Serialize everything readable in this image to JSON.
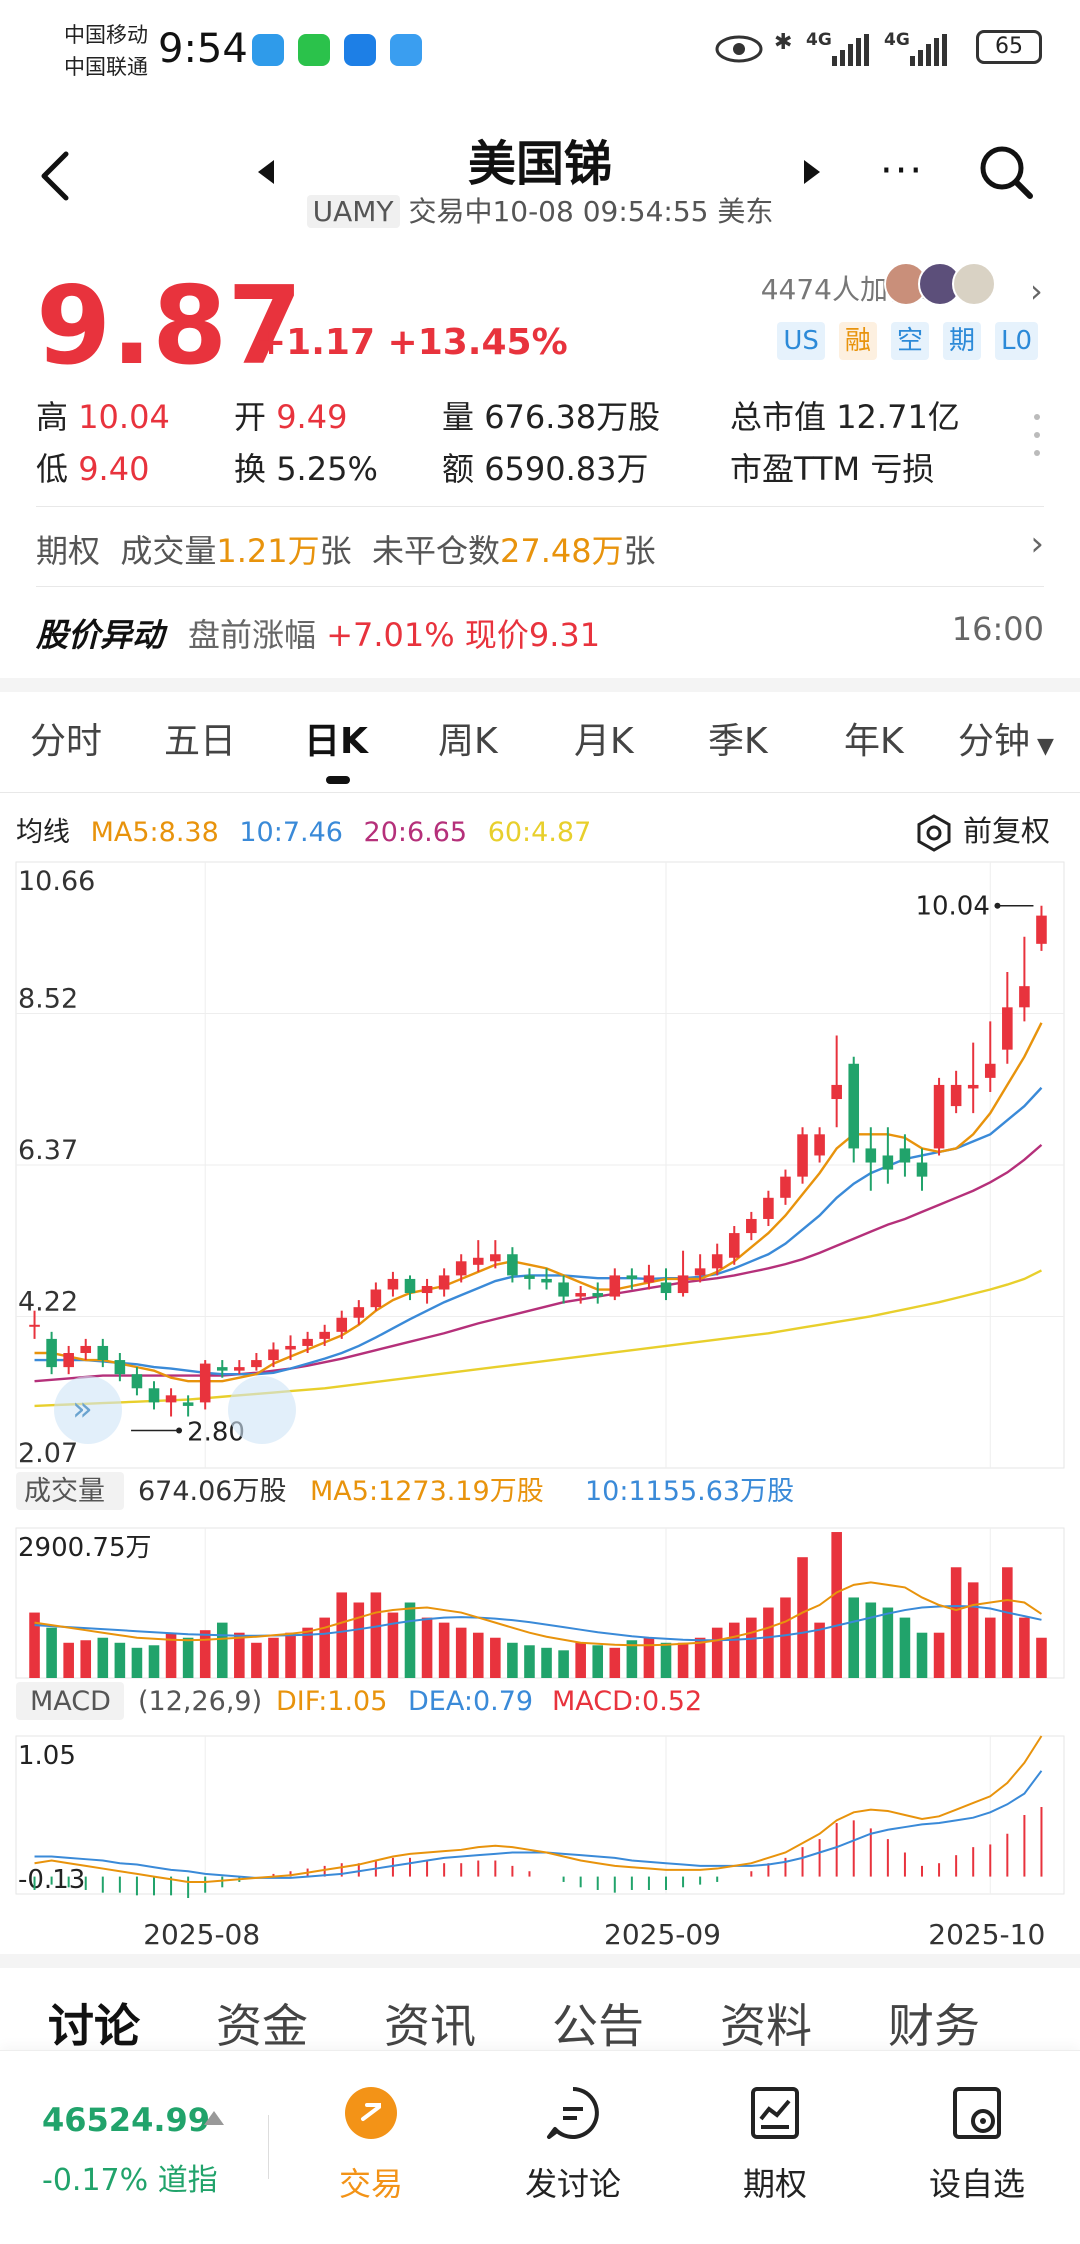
{
  "status_bar": {
    "carrier1": "中国移动",
    "carrier2": "中国联通",
    "time": "9:54",
    "network1": "4G",
    "network2": "4G",
    "battery": "65"
  },
  "header": {
    "title": "美国锑",
    "ticker": "UAMY",
    "status": "交易中10-08 09:54:55 美东"
  },
  "quote": {
    "price": "9.87",
    "change": "+1.17",
    "change_pct": "+13.45%",
    "watch_count": "4474人加自选",
    "badges": [
      "US",
      "融",
      "空",
      "期",
      "L0"
    ]
  },
  "stats": {
    "high_label": "高",
    "high": "10.04",
    "open_label": "开",
    "open": "9.49",
    "volume_label": "量",
    "volume": "676.38万股",
    "mcap_label": "总市值",
    "mcap": "12.71亿",
    "low_label": "低",
    "low": "9.40",
    "turnover_label": "换",
    "turnover": "5.25%",
    "amount_label": "额",
    "amount": "6590.83万",
    "pe_label": "市盈TTM",
    "pe": "亏损"
  },
  "options": {
    "label": "期权",
    "vol_label": "成交量",
    "vol": "1.21万",
    "vol_unit": "张",
    "oi_label": "未平仓数",
    "oi": "27.48万",
    "oi_unit": "张"
  },
  "alert": {
    "title": "股价异动",
    "text": "盘前涨幅",
    "pct": "+7.01%",
    "now": "现价9.31",
    "time": "16:00"
  },
  "tabs": [
    "分时",
    "五日",
    "日K",
    "周K",
    "月K",
    "季K",
    "年K",
    "分钟"
  ],
  "ma": {
    "label": "均线",
    "ma5": "MA5:8.38",
    "ma10": "10:7.46",
    "ma20": "20:6.65",
    "ma60": "60:4.87",
    "adjust": "前复权"
  },
  "volume_info": {
    "label": "成交量",
    "value": "674.06万股",
    "ma5": "MA5:1273.19万股",
    "ma10": "10:1155.63万股",
    "max": "2900.75万"
  },
  "macd_info": {
    "label": "MACD",
    "params": "(12,26,9)",
    "dif": "DIF:1.05",
    "dea": "DEA:0.79",
    "macd": "MACD:0.52",
    "top": "1.05",
    "bottom": "-0.13"
  },
  "chart_data": {
    "type": "candlestick",
    "y_ticks": [
      "10.66",
      "8.52",
      "6.37",
      "4.22",
      "2.07"
    ],
    "ylim": [
      2.07,
      10.66
    ],
    "x_labels": [
      "2025-08",
      "2025-09",
      "2025-10"
    ],
    "high_marker": "10.04",
    "low_marker": "2.80",
    "candles": [
      [
        4.1,
        4.1,
        3.9,
        4.3
      ],
      [
        3.9,
        3.5,
        3.4,
        4.0
      ],
      [
        3.5,
        3.7,
        3.4,
        3.8
      ],
      [
        3.7,
        3.8,
        3.6,
        3.9
      ],
      [
        3.8,
        3.6,
        3.5,
        3.9
      ],
      [
        3.6,
        3.4,
        3.3,
        3.7
      ],
      [
        3.4,
        3.2,
        3.1,
        3.5
      ],
      [
        3.2,
        3.0,
        2.9,
        3.3
      ],
      [
        3.0,
        3.1,
        2.8,
        3.2
      ],
      [
        3.0,
        2.95,
        2.8,
        3.1
      ],
      [
        3.0,
        3.55,
        2.9,
        3.6
      ],
      [
        3.5,
        3.45,
        3.35,
        3.6
      ],
      [
        3.45,
        3.5,
        3.4,
        3.6
      ],
      [
        3.5,
        3.6,
        3.45,
        3.7
      ],
      [
        3.6,
        3.75,
        3.5,
        3.85
      ],
      [
        3.75,
        3.8,
        3.6,
        3.95
      ],
      [
        3.8,
        3.9,
        3.7,
        4.0
      ],
      [
        3.9,
        4.0,
        3.8,
        4.1
      ],
      [
        4.0,
        4.2,
        3.9,
        4.3
      ],
      [
        4.2,
        4.35,
        4.1,
        4.45
      ],
      [
        4.35,
        4.6,
        4.3,
        4.7
      ],
      [
        4.6,
        4.75,
        4.5,
        4.85
      ],
      [
        4.75,
        4.55,
        4.45,
        4.8
      ],
      [
        4.55,
        4.65,
        4.4,
        4.75
      ],
      [
        4.6,
        4.8,
        4.5,
        4.9
      ],
      [
        4.8,
        5.0,
        4.7,
        5.1
      ],
      [
        4.95,
        5.05,
        4.85,
        5.3
      ],
      [
        5.0,
        5.1,
        4.9,
        5.3
      ],
      [
        5.1,
        4.8,
        4.7,
        5.2
      ],
      [
        4.8,
        4.75,
        4.6,
        4.9
      ],
      [
        4.75,
        4.7,
        4.6,
        4.9
      ],
      [
        4.7,
        4.5,
        4.4,
        4.8
      ],
      [
        4.5,
        4.55,
        4.4,
        4.65
      ],
      [
        4.55,
        4.5,
        4.4,
        4.7
      ],
      [
        4.5,
        4.8,
        4.45,
        4.9
      ],
      [
        4.8,
        4.75,
        4.6,
        4.9
      ],
      [
        4.7,
        4.8,
        4.6,
        4.95
      ],
      [
        4.7,
        4.55,
        4.45,
        4.9
      ],
      [
        4.55,
        4.8,
        4.5,
        5.15
      ],
      [
        4.8,
        4.9,
        4.7,
        5.1
      ],
      [
        4.9,
        5.1,
        4.8,
        5.25
      ],
      [
        5.05,
        5.4,
        4.95,
        5.5
      ],
      [
        5.4,
        5.6,
        5.3,
        5.7
      ],
      [
        5.6,
        5.9,
        5.5,
        6.0
      ],
      [
        5.9,
        6.2,
        5.8,
        6.3
      ],
      [
        6.2,
        6.8,
        6.1,
        6.9
      ],
      [
        6.5,
        6.8,
        6.4,
        6.9
      ],
      [
        7.3,
        7.5,
        6.9,
        8.2
      ],
      [
        7.8,
        6.6,
        6.4,
        7.9
      ],
      [
        6.6,
        6.4,
        6.0,
        6.9
      ],
      [
        6.5,
        6.3,
        6.1,
        6.9
      ],
      [
        6.6,
        6.4,
        6.2,
        6.8
      ],
      [
        6.4,
        6.2,
        6.0,
        6.6
      ],
      [
        6.6,
        7.5,
        6.5,
        7.6
      ],
      [
        7.2,
        7.5,
        7.1,
        7.7
      ],
      [
        7.45,
        7.5,
        7.1,
        8.1
      ],
      [
        7.6,
        7.8,
        7.4,
        8.4
      ],
      [
        8.0,
        8.6,
        7.8,
        9.1
      ],
      [
        8.6,
        8.9,
        8.4,
        9.6
      ],
      [
        9.5,
        9.9,
        9.4,
        10.04
      ]
    ],
    "ma5": [
      3.7,
      3.7,
      3.65,
      3.6,
      3.6,
      3.55,
      3.5,
      3.45,
      3.35,
      3.3,
      3.3,
      3.3,
      3.35,
      3.4,
      3.55,
      3.65,
      3.75,
      3.85,
      3.95,
      4.1,
      4.3,
      4.45,
      4.55,
      4.6,
      4.65,
      4.75,
      4.85,
      4.95,
      5.0,
      4.95,
      4.9,
      4.8,
      4.7,
      4.6,
      4.6,
      4.65,
      4.7,
      4.75,
      4.75,
      4.75,
      4.85,
      5.0,
      5.2,
      5.4,
      5.65,
      5.95,
      6.25,
      6.6,
      6.8,
      6.8,
      6.8,
      6.75,
      6.6,
      6.55,
      6.6,
      6.8,
      7.1,
      7.5,
      7.9,
      8.38
    ],
    "ma10": [
      3.6,
      3.6,
      3.6,
      3.6,
      3.58,
      3.56,
      3.54,
      3.5,
      3.48,
      3.45,
      3.42,
      3.4,
      3.4,
      3.4,
      3.42,
      3.48,
      3.55,
      3.62,
      3.7,
      3.8,
      3.92,
      4.05,
      4.18,
      4.3,
      4.42,
      4.52,
      4.62,
      4.72,
      4.78,
      4.8,
      4.8,
      4.8,
      4.78,
      4.76,
      4.76,
      4.76,
      4.75,
      4.76,
      4.76,
      4.78,
      4.82,
      4.9,
      5.0,
      5.1,
      5.25,
      5.45,
      5.65,
      5.9,
      6.1,
      6.25,
      6.35,
      6.45,
      6.5,
      6.55,
      6.6,
      6.7,
      6.8,
      7.0,
      7.2,
      7.46
    ],
    "ma20": [
      3.3,
      3.32,
      3.34,
      3.36,
      3.38,
      3.38,
      3.38,
      3.38,
      3.38,
      3.38,
      3.38,
      3.38,
      3.4,
      3.42,
      3.45,
      3.48,
      3.52,
      3.57,
      3.62,
      3.68,
      3.74,
      3.8,
      3.86,
      3.92,
      3.98,
      4.05,
      4.12,
      4.18,
      4.24,
      4.3,
      4.36,
      4.42,
      4.46,
      4.5,
      4.54,
      4.58,
      4.62,
      4.66,
      4.7,
      4.73,
      4.76,
      4.8,
      4.85,
      4.9,
      4.96,
      5.03,
      5.12,
      5.22,
      5.32,
      5.42,
      5.52,
      5.6,
      5.7,
      5.8,
      5.9,
      6.0,
      6.12,
      6.26,
      6.44,
      6.65
    ],
    "ma60": [
      2.95,
      2.96,
      2.97,
      2.98,
      2.99,
      3.0,
      3.01,
      3.02,
      3.03,
      3.04,
      3.06,
      3.08,
      3.1,
      3.12,
      3.14,
      3.16,
      3.18,
      3.2,
      3.23,
      3.26,
      3.29,
      3.32,
      3.35,
      3.38,
      3.41,
      3.44,
      3.47,
      3.5,
      3.53,
      3.56,
      3.59,
      3.62,
      3.65,
      3.68,
      3.71,
      3.74,
      3.77,
      3.8,
      3.83,
      3.86,
      3.89,
      3.92,
      3.95,
      3.98,
      4.02,
      4.06,
      4.1,
      4.14,
      4.18,
      4.22,
      4.27,
      4.32,
      4.37,
      4.42,
      4.48,
      4.54,
      4.6,
      4.67,
      4.75,
      4.87
    ],
    "volumes": [
      1300,
      1000,
      700,
      750,
      800,
      700,
      600,
      650,
      900,
      800,
      950,
      1100,
      900,
      700,
      800,
      900,
      1000,
      1200,
      1700,
      1500,
      1700,
      1300,
      1500,
      1200,
      1100,
      1000,
      900,
      800,
      700,
      650,
      600,
      550,
      700,
      650,
      600,
      750,
      800,
      700,
      700,
      800,
      1000,
      1100,
      1200,
      1400,
      1600,
      2400,
      1100,
      2900,
      1600,
      1500,
      1400,
      1200,
      900,
      900,
      2200,
      1900,
      1200,
      2200,
      1200,
      800
    ],
    "vol_ma5": [
      1100,
      1050,
      1000,
      950,
      900,
      850,
      800,
      780,
      760,
      750,
      760,
      780,
      800,
      820,
      850,
      880,
      920,
      1000,
      1100,
      1200,
      1300,
      1350,
      1380,
      1400,
      1350,
      1300,
      1200,
      1100,
      1000,
      900,
      820,
      760,
      700,
      680,
      660,
      650,
      650,
      660,
      680,
      700,
      750,
      820,
      900,
      1000,
      1120,
      1300,
      1450,
      1700,
      1850,
      1900,
      1850,
      1800,
      1600,
      1450,
      1350,
      1450,
      1500,
      1550,
      1500,
      1273
    ],
    "vol_ma10": [
      1050,
      1030,
      1010,
      990,
      970,
      950,
      930,
      910,
      890,
      870,
      860,
      850,
      840,
      840,
      845,
      850,
      860,
      880,
      920,
      970,
      1020,
      1080,
      1130,
      1170,
      1200,
      1210,
      1200,
      1180,
      1150,
      1110,
      1060,
      1010,
      960,
      910,
      870,
      830,
      800,
      780,
      760,
      750,
      750,
      760,
      780,
      810,
      850,
      900,
      960,
      1040,
      1120,
      1200,
      1280,
      1350,
      1400,
      1420,
      1430,
      1420,
      1380,
      1300,
      1230,
      1156
    ],
    "dif": [
      0.1,
      0.12,
      0.1,
      0.08,
      0.06,
      0.04,
      0.02,
      0.0,
      -0.02,
      -0.04,
      -0.04,
      -0.03,
      -0.02,
      -0.01,
      0.0,
      0.01,
      0.03,
      0.05,
      0.07,
      0.09,
      0.12,
      0.15,
      0.17,
      0.18,
      0.19,
      0.2,
      0.22,
      0.23,
      0.22,
      0.2,
      0.18,
      0.15,
      0.12,
      0.1,
      0.08,
      0.07,
      0.06,
      0.05,
      0.05,
      0.05,
      0.06,
      0.08,
      0.1,
      0.14,
      0.18,
      0.25,
      0.32,
      0.42,
      0.48,
      0.5,
      0.49,
      0.46,
      0.43,
      0.45,
      0.5,
      0.55,
      0.6,
      0.7,
      0.85,
      1.05
    ],
    "dea": [
      0.15,
      0.15,
      0.14,
      0.13,
      0.12,
      0.1,
      0.09,
      0.07,
      0.05,
      0.04,
      0.02,
      0.01,
      0.0,
      -0.01,
      -0.01,
      -0.01,
      0.0,
      0.01,
      0.02,
      0.04,
      0.06,
      0.08,
      0.1,
      0.12,
      0.14,
      0.15,
      0.16,
      0.17,
      0.18,
      0.18,
      0.18,
      0.17,
      0.16,
      0.15,
      0.14,
      0.12,
      0.11,
      0.1,
      0.09,
      0.08,
      0.08,
      0.08,
      0.08,
      0.09,
      0.11,
      0.14,
      0.18,
      0.22,
      0.27,
      0.32,
      0.35,
      0.37,
      0.39,
      0.4,
      0.42,
      0.44,
      0.48,
      0.54,
      0.62,
      0.79
    ]
  },
  "info_tabs": [
    "讨论",
    "资金",
    "资讯",
    "公告",
    "资料",
    "财务"
  ],
  "bottom": {
    "index_value": "46524.99",
    "index_change": "-0.17%",
    "index_name": "道指",
    "nav": [
      "交易",
      "发讨论",
      "期权",
      "设自选"
    ]
  },
  "colors": {
    "up": "#e8333d",
    "down": "#21a36b",
    "ma5": "#e8930c",
    "ma10": "#3a8ad8",
    "ma20": "#b5307a",
    "ma60": "#e8cf2c"
  }
}
